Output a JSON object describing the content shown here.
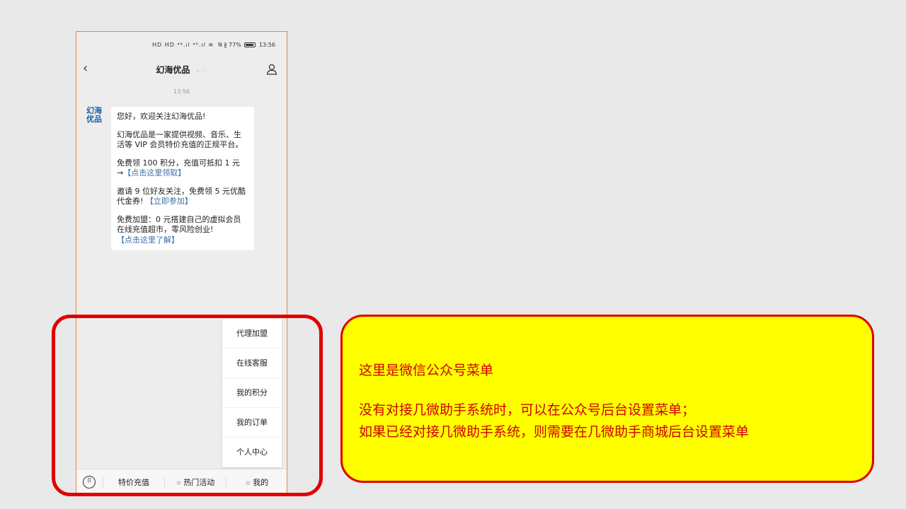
{
  "statusbar": {
    "signal": "HD HD ⁴⁶.ıl ⁴⁶.ıl ≋",
    "battery_pct": "N ∦ 77%",
    "time": "13:56"
  },
  "navbar": {
    "back": "‹",
    "title": "幻海优品",
    "subtitle": "⌕ ♡"
  },
  "chat": {
    "time": "13:56",
    "avatar_text": "幻海优品",
    "message": {
      "p1": "您好，欢迎关注幻海优品!",
      "p2": "幻海优品是一家提供视频、音乐、生活等 VIP 会员特价充值的正规平台。",
      "p3_text": "免费领 100 积分，充值可抵扣 1 元 →",
      "p3_link": "【点击这里领取】",
      "p4_text": "邀请 9 位好友关注，免费领 5 元优酷代金券!",
      "p4_link": "【立即参加】",
      "p5_text": "免费加盟：0 元搭建自己的虚拟会员在线充值超市，零风险创业!",
      "p5_link": "【点击这里了解】"
    }
  },
  "submenu": [
    "代理加盟",
    "在线客服",
    "我的积分",
    "我的订单",
    "个人中心"
  ],
  "bottombar": {
    "tab1": "特价充值",
    "tab2": "热门活动",
    "tab3": "我的",
    "ham": "≡"
  },
  "note": {
    "line1": "这里是微信公众号菜单",
    "line2": "没有对接几微助手系统时，可以在公众号后台设置菜单；",
    "line3": "如果已经对接几微助手系统，则需要在几微助手商城后台设置菜单"
  },
  "colors": {
    "highlight_border": "#e00000",
    "note_bg": "#ffff00",
    "note_text": "#d00000",
    "link": "#3d6fa8"
  }
}
